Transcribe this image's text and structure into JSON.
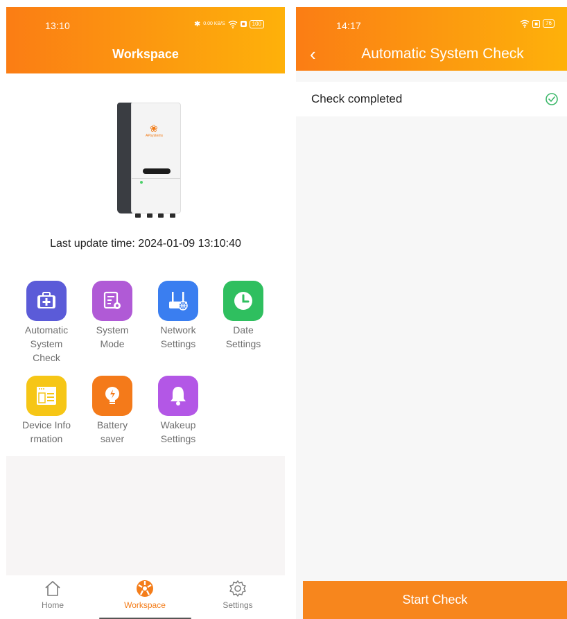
{
  "left": {
    "status": {
      "time": "13:10",
      "net_speed": "0.00 KB/S",
      "battery": "100"
    },
    "title": "Workspace",
    "last_update": "Last update time: 2024-01-09 13:10:40",
    "inverter_brand": "APsystems",
    "grid": [
      {
        "label": "Automatic System Check",
        "icon": "medkit-icon",
        "color": "#5b5bd8"
      },
      {
        "label": "System Mode",
        "icon": "settings-doc-icon",
        "color": "#b05ad6"
      },
      {
        "label": "Network Settings",
        "icon": "router-icon",
        "color": "#3a7ef0"
      },
      {
        "label": "Date Settings",
        "icon": "clock-icon",
        "color": "#2fbf5f"
      },
      {
        "label": "Device Information",
        "label_lines": [
          "Device Info",
          "rmation"
        ],
        "icon": "window-icon",
        "color": "#f6c616"
      },
      {
        "label": "Battery saver",
        "icon": "bulb-icon",
        "color": "#f47a1a"
      },
      {
        "label": "Wakeup Settings",
        "icon": "bell-icon",
        "color": "#b357e6"
      }
    ],
    "nav": [
      {
        "label": "Home",
        "icon": "home-icon",
        "active": false
      },
      {
        "label": "Workspace",
        "icon": "workspace-icon",
        "active": true
      },
      {
        "label": "Settings",
        "icon": "gear-icon",
        "active": false
      }
    ]
  },
  "right": {
    "status": {
      "time": "14:17",
      "battery": "76"
    },
    "title": "Automatic System Check",
    "check_text": "Check completed",
    "start_button": "Start Check"
  },
  "colors": {
    "accent": "#fb8a14",
    "button": "#f7861d",
    "success": "#3cb86a"
  }
}
